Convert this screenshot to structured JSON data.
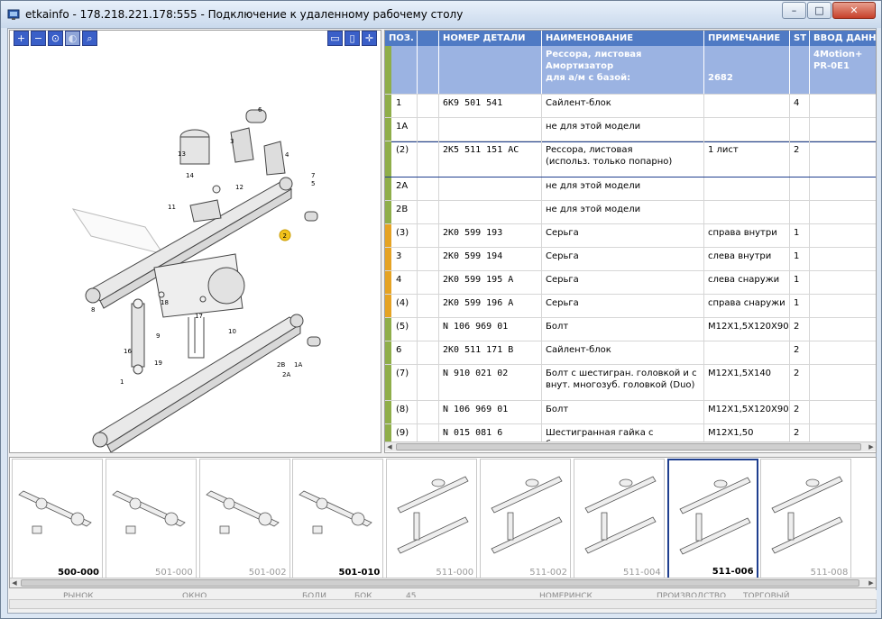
{
  "window": {
    "title": "etkainfo - 178.218.221.178:555 - Подключение к удаленному рабочему столу",
    "min_label": "–",
    "max_label": "□",
    "close_label": "✕"
  },
  "toolbar": {
    "zoom_in_icon": "+",
    "zoom_out_icon": "−",
    "zoom_fit_icon": "⊙",
    "zoom_prev_icon": "◐",
    "search_icon": "⌕",
    "layout_icon": "▭",
    "split_icon": "▯",
    "expand_icon": "✛"
  },
  "drawing": {
    "callouts": [
      "6",
      "3",
      "4",
      "13",
      "7",
      "5",
      "14",
      "12",
      "11",
      "2",
      "8",
      "18",
      "17",
      "9",
      "16",
      "19",
      "10",
      "2B",
      "1A",
      "2A",
      "1"
    ]
  },
  "table": {
    "columns": [
      "ПОЗ.",
      "",
      "НОМЕР ДЕТАЛИ",
      "НАИМЕНОВАНИЕ",
      "ПРИМЕЧАНИЕ",
      "ST",
      "ВВОД ДАННЫХ"
    ],
    "header_row": {
      "pos": "",
      "part": "",
      "name": "Рессора, листовая\nАмортизатор\n  для а/м с базой:",
      "note": "\n\n2682",
      "st": "",
      "input": "4Motion+\nPR-0E1"
    },
    "rows": [
      {
        "pos": "1",
        "part": "6K9  501  541",
        "name": "Сайлент-блок",
        "note": "",
        "st": "4",
        "mark": "#8fae4a"
      },
      {
        "pos": "1A",
        "part": "",
        "name": "не для этой модели",
        "note": "",
        "st": "",
        "mark": "#8fae4a"
      },
      {
        "pos": "(2)",
        "part": "2K5  511  151  AC",
        "name": "Рессора, листовая\n(использ. только попарно)",
        "note": "1 лист",
        "st": "2",
        "mark": "#8fae4a"
      },
      {
        "pos": "2A",
        "part": "",
        "name": "не для этой модели",
        "note": "",
        "st": "",
        "mark": "#8fae4a"
      },
      {
        "pos": "2B",
        "part": "",
        "name": "не для этой модели",
        "note": "",
        "st": "",
        "mark": "#8fae4a"
      },
      {
        "pos": "(3)",
        "part": "2K0  599  193",
        "name": "Серьга",
        "note": "справа внутри",
        "st": "1",
        "mark": "#e5a324"
      },
      {
        "pos": "3",
        "part": "2K0  599  194",
        "name": "Серьга",
        "note": "слева внутри",
        "st": "1",
        "mark": "#e5a324"
      },
      {
        "pos": "4",
        "part": "2K0  599  195  A",
        "name": "Серьга",
        "note": "слева снаружи",
        "st": "1",
        "mark": "#e5a324"
      },
      {
        "pos": "(4)",
        "part": "2K0  599  196  A",
        "name": "Серьга",
        "note": "справа снаружи",
        "st": "1",
        "mark": "#e5a324"
      },
      {
        "pos": "(5)",
        "part": "N    106  969  01",
        "name": "Болт",
        "note": "M12X1,5X120X90",
        "st": "2",
        "mark": "#8fae4a"
      },
      {
        "pos": "6",
        "part": "2K0  511  171  B",
        "name": "Сайлент-блок",
        "note": "",
        "st": "2",
        "mark": "#8fae4a"
      },
      {
        "pos": "(7)",
        "part": "N    910  021  02",
        "name": "Болт с шестигран. головкой и с\nвнут. многозуб. головкой (Duo)",
        "note": "M12X1,5X140",
        "st": "2",
        "mark": "#8fae4a"
      },
      {
        "pos": "(8)",
        "part": "N    106  969  01",
        "name": "Болт",
        "note": "M12X1,5X120X90",
        "st": "2",
        "mark": "#8fae4a"
      },
      {
        "pos": "(9)",
        "part": "N    015  081  6",
        "name": "Шестигранная гайка с буртиком",
        "note": "M12X1,50",
        "st": "2",
        "mark": "#8fae4a"
      }
    ]
  },
  "thumbnails": [
    {
      "label": "500-000",
      "active": false,
      "bold": true
    },
    {
      "label": "501-000",
      "active": false,
      "bold": false
    },
    {
      "label": "501-002",
      "active": false,
      "bold": false
    },
    {
      "label": "501-010",
      "active": false,
      "bold": true
    },
    {
      "label": "511-000",
      "active": false,
      "bold": false
    },
    {
      "label": "511-002",
      "active": false,
      "bold": false
    },
    {
      "label": "511-004",
      "active": false,
      "bold": false
    },
    {
      "label": "511-006",
      "active": true,
      "bold": true
    },
    {
      "label": "511-008",
      "active": false,
      "bold": false
    }
  ],
  "status": {
    "cells": [
      "РЫНОК",
      "ОКНО",
      "БОДИ",
      "БОК",
      "45",
      "НОМЕРИНСК",
      "ПРОИЗВОДСТВО",
      "ТОРГОВЫЙ"
    ]
  },
  "colors": {
    "header_bg": "#4f7ac4",
    "group_row_bg": "#9bb3e2",
    "mark_green": "#8fae4a",
    "mark_orange": "#e5a324",
    "callout_yellow": "#f2c21c"
  }
}
